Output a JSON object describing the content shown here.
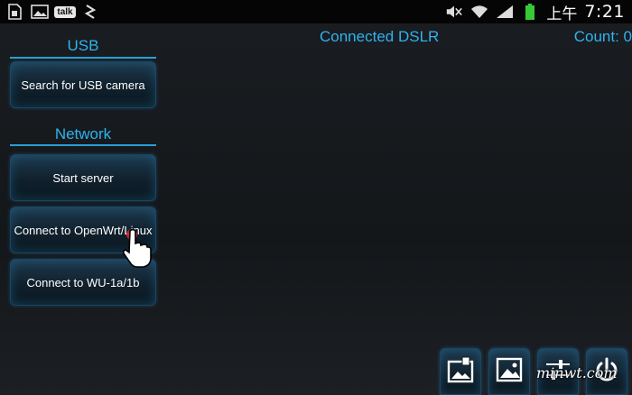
{
  "status_bar": {
    "talk_label": "talk",
    "ampm": "上午",
    "time": "7:21",
    "icons_left": [
      "sd-card-icon",
      "gallery-icon",
      "talk-icon",
      "usb-icon"
    ],
    "icons_right": [
      "mute-icon",
      "wifi-icon",
      "signal-icon",
      "battery-icon"
    ],
    "battery_color": "#37c837"
  },
  "header": {
    "title": "Connected DSLR",
    "count": "Count: 0"
  },
  "sidebar": {
    "usb_title": "USB",
    "usb_buttons": [
      {
        "label": "Search for USB camera"
      }
    ],
    "network_title": "Network",
    "network_buttons": [
      {
        "label": "Start server"
      },
      {
        "label": "Connect to OpenWrt/Linux"
      },
      {
        "label": "Connect to WU-1a/1b"
      }
    ]
  },
  "toolbar": {
    "buttons": [
      "gallery-delete-icon",
      "gallery-icon",
      "sliders-icon",
      "power-icon"
    ]
  },
  "watermark": "minwt.com",
  "colors": {
    "accent": "#2fb3ee",
    "background": "#16191c"
  }
}
